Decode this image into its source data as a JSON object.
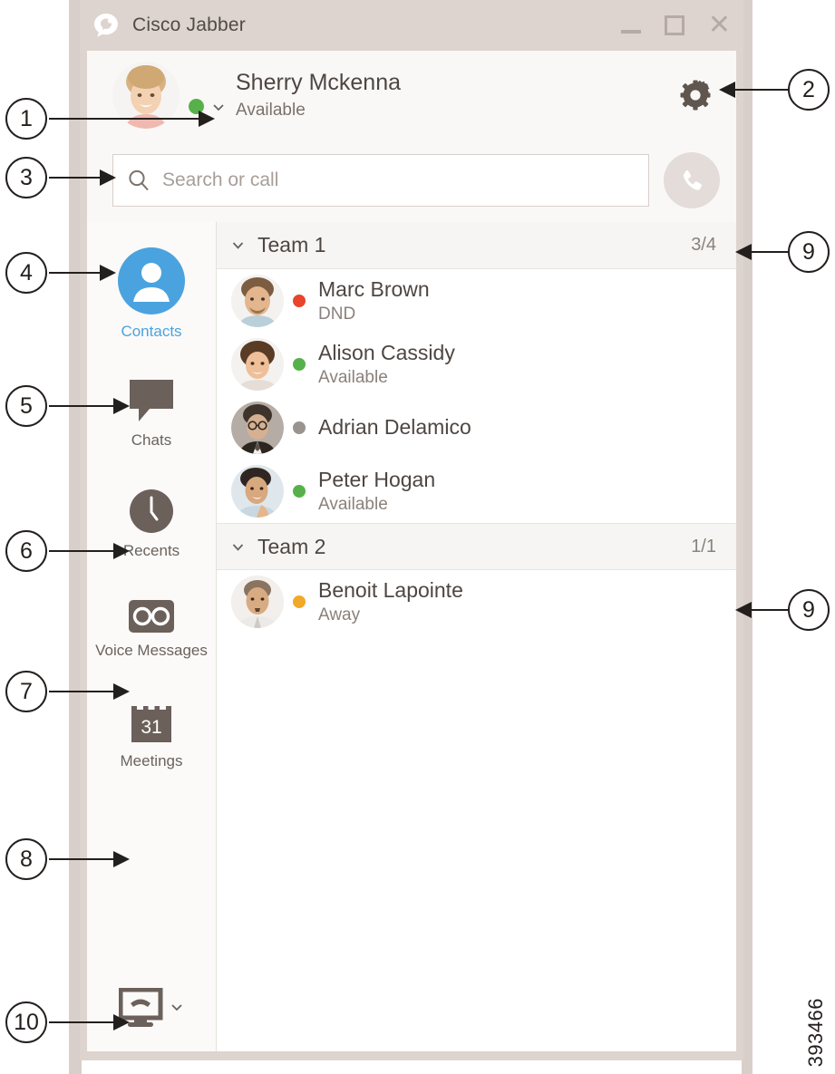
{
  "window": {
    "title": "Cisco Jabber",
    "logo_icon": "jabber-logo-icon",
    "minimize_label": "—",
    "maximize_label": "☐",
    "close_label": "✕"
  },
  "profile": {
    "name": "Sherry Mckenna",
    "status": "Available",
    "presence_color": "#57b14a",
    "settings_icon": "gear-icon",
    "presence_caret_icon": "chevron-down-icon"
  },
  "search": {
    "placeholder": "Search or call",
    "value": "",
    "icon": "search-icon",
    "call_icon": "phone-handset-icon"
  },
  "sidebar": {
    "items": [
      {
        "label": "Contacts",
        "icon": "person-icon",
        "active": true,
        "accent": "#4aa3df"
      },
      {
        "label": "Chats",
        "icon": "speech-bubble-icon",
        "active": false,
        "accent": "#6b625d"
      },
      {
        "label": "Recents",
        "icon": "clock-icon",
        "active": false,
        "accent": "#6b625d"
      },
      {
        "label": "Voice Messages",
        "icon": "voicemail-icon",
        "active": false,
        "accent": "#6b625d"
      },
      {
        "label": "Meetings",
        "icon": "calendar-31-icon",
        "active": false,
        "accent": "#6b625d"
      }
    ],
    "device_selector": {
      "icon": "desktop-phone-icon",
      "caret_icon": "chevron-down-icon"
    }
  },
  "contacts": {
    "groups": [
      {
        "name": "Team 1",
        "count": "3/4",
        "caret_icon": "chevron-down-icon",
        "members": [
          {
            "name": "Marc Brown",
            "status": "DND",
            "presence_color": "#e8452c",
            "avatar": "avatar-marc-brown"
          },
          {
            "name": "Alison Cassidy",
            "status": "Available",
            "presence_color": "#57b14a",
            "avatar": "avatar-alison-cassidy"
          },
          {
            "name": "Adrian Delamico",
            "status": "",
            "presence_color": "#9b938d",
            "avatar": "avatar-adrian-delamico"
          },
          {
            "name": "Peter Hogan",
            "status": "Available",
            "presence_color": "#57b14a",
            "avatar": "avatar-peter-hogan"
          }
        ]
      },
      {
        "name": "Team 2",
        "count": "1/1",
        "caret_icon": "chevron-down-icon",
        "members": [
          {
            "name": "Benoit Lapointe",
            "status": "Away",
            "presence_color": "#f0a92b",
            "avatar": "avatar-benoit-lapointe"
          }
        ]
      }
    ]
  },
  "callouts": [
    {
      "id": "1",
      "label": "1"
    },
    {
      "id": "2",
      "label": "2"
    },
    {
      "id": "3",
      "label": "3"
    },
    {
      "id": "4",
      "label": "4"
    },
    {
      "id": "5",
      "label": "5"
    },
    {
      "id": "6",
      "label": "6"
    },
    {
      "id": "7",
      "label": "7"
    },
    {
      "id": "8",
      "label": "8"
    },
    {
      "id": "9a",
      "label": "9"
    },
    {
      "id": "9b",
      "label": "9"
    },
    {
      "id": "10",
      "label": "10"
    }
  ],
  "figure_number": "393466"
}
